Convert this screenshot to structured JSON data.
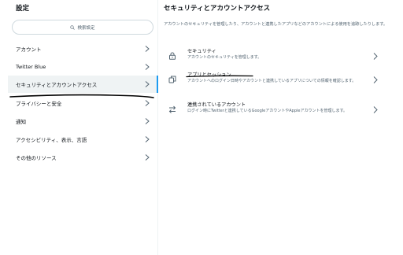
{
  "sidebar": {
    "title": "設定",
    "search_placeholder": "検索設定",
    "items": [
      {
        "label": "アカウント"
      },
      {
        "label": "Twitter Blue"
      },
      {
        "label": "セキュリティとアカウントアクセス"
      },
      {
        "label": "プライバシーと安全"
      },
      {
        "label": "通知"
      },
      {
        "label": "アクセシビリティ、表示、言語"
      },
      {
        "label": "その他のリソース"
      }
    ],
    "active_index": 2
  },
  "main": {
    "title": "セキュリティとアカウントアクセス",
    "description": "アカウントのセキュリティを管理したり、アカウントと連携したアプリなどのアカウントによる使用を追跡したりします。",
    "options": [
      {
        "icon": "lock-icon",
        "title": "セキュリティ",
        "description": "アカウントのセキュリティを管理します。"
      },
      {
        "icon": "apps-icon",
        "title": "アプリとセッション",
        "description": "アカウントへのログイン日時やアカウントと連携しているアプリについての情報を確認します。"
      },
      {
        "icon": "swap-icon",
        "title": "連携されているアカウント",
        "description": "ログイン時にTwitterと連携しているGoogleアカウントやAppleアカウントを管理します。"
      }
    ]
  },
  "colors": {
    "accent": "#1d9bf0",
    "text": "#0f1419",
    "muted": "#536471",
    "active_bg": "#eff3f4",
    "pen_annotation": "#000000"
  }
}
